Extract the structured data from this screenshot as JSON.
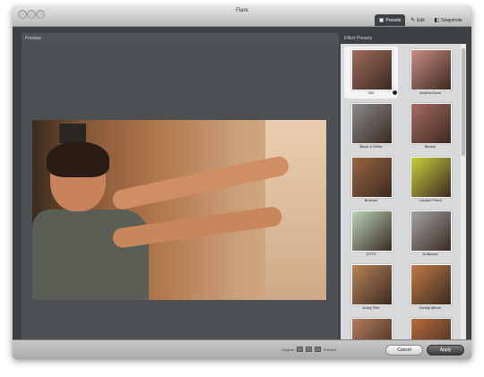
{
  "window": {
    "title": "Flare"
  },
  "toolbar": {
    "left_label": "",
    "tabs": [
      {
        "label": "Presets",
        "icon": "presets-icon"
      },
      {
        "label": "Edit",
        "icon": "edit-icon"
      },
      {
        "label": "Snapshots",
        "icon": "snapshots-icon"
      }
    ]
  },
  "preview": {
    "header": "Preview"
  },
  "presets": {
    "header": "Effect Presets",
    "items": [
      {
        "label": "300",
        "color": "#9f6b5a",
        "selected": true
      },
      {
        "label": "Andrea Doria",
        "color": "#c98c83"
      },
      {
        "label": "Black & White",
        "color": "#8a8a8a"
      },
      {
        "label": "Bleach",
        "color": "#a86b62"
      },
      {
        "label": "Brownie",
        "color": "#9b6640"
      },
      {
        "label": "Caution Prinnt",
        "color": "#c8d03c"
      },
      {
        "label": "CCTV",
        "color": "#b9d3b9"
      },
      {
        "label": "Driftwood",
        "color": "#a3a3a3"
      },
      {
        "label": "Dusty Film",
        "color": "#b88457"
      },
      {
        "label": "Family Album",
        "color": "#c07a45"
      },
      {
        "label": "",
        "color": "#b57b5a"
      },
      {
        "label": "",
        "color": "#b86a3a"
      }
    ]
  },
  "bottom": {
    "compare_left": "Original",
    "compare_right": "Preview",
    "cancel": "Cancel",
    "apply": "Apply"
  }
}
